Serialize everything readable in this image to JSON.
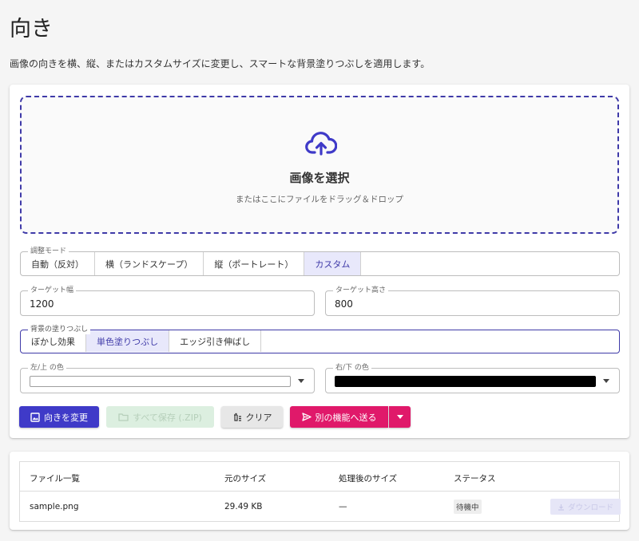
{
  "page": {
    "title": "向き",
    "description": "画像の向きを横、縦、またはカスタムサイズに変更し、スマートな背景塗りつぶしを適用します。"
  },
  "dropzone": {
    "title": "画像を選択",
    "subtitle": "またはここにファイルをドラッグ＆ドロップ",
    "icon": "cloud-upload-icon"
  },
  "adjust_mode": {
    "legend": "調整モード",
    "options": [
      "自動（反対）",
      "横（ランドスケープ）",
      "縦（ポートレート）",
      "カスタム"
    ],
    "selected": "カスタム"
  },
  "target_width": {
    "label": "ターゲット幅",
    "value": "1200"
  },
  "target_height": {
    "label": "ターゲット高さ",
    "value": "800"
  },
  "background_fill": {
    "legend": "背景の塗りつぶし",
    "options": [
      "ぼかし効果",
      "単色塗りつぶし",
      "エッジ引き伸ばし"
    ],
    "selected": "単色塗りつぶし"
  },
  "color_left_top": {
    "label": "左/上 の色",
    "color": "#ffffff"
  },
  "color_right_bottom": {
    "label": "右/下 の色",
    "color": "#000000"
  },
  "actions": {
    "apply": "向きを変更",
    "save_all": "すべて保存 (.ZIP)",
    "clear": "クリア",
    "send": "別の機能へ送る"
  },
  "colors": {
    "accent": "#3f3ac8",
    "pink": "#e0196a"
  },
  "table": {
    "headers": [
      "ファイル一覧",
      "元のサイズ",
      "処理後のサイズ",
      "ステータス"
    ],
    "rows": [
      {
        "name": "sample.png",
        "original_size": "29.49 KB",
        "processed_size": "—",
        "status": "待機中",
        "download": "ダウンロード"
      }
    ]
  }
}
